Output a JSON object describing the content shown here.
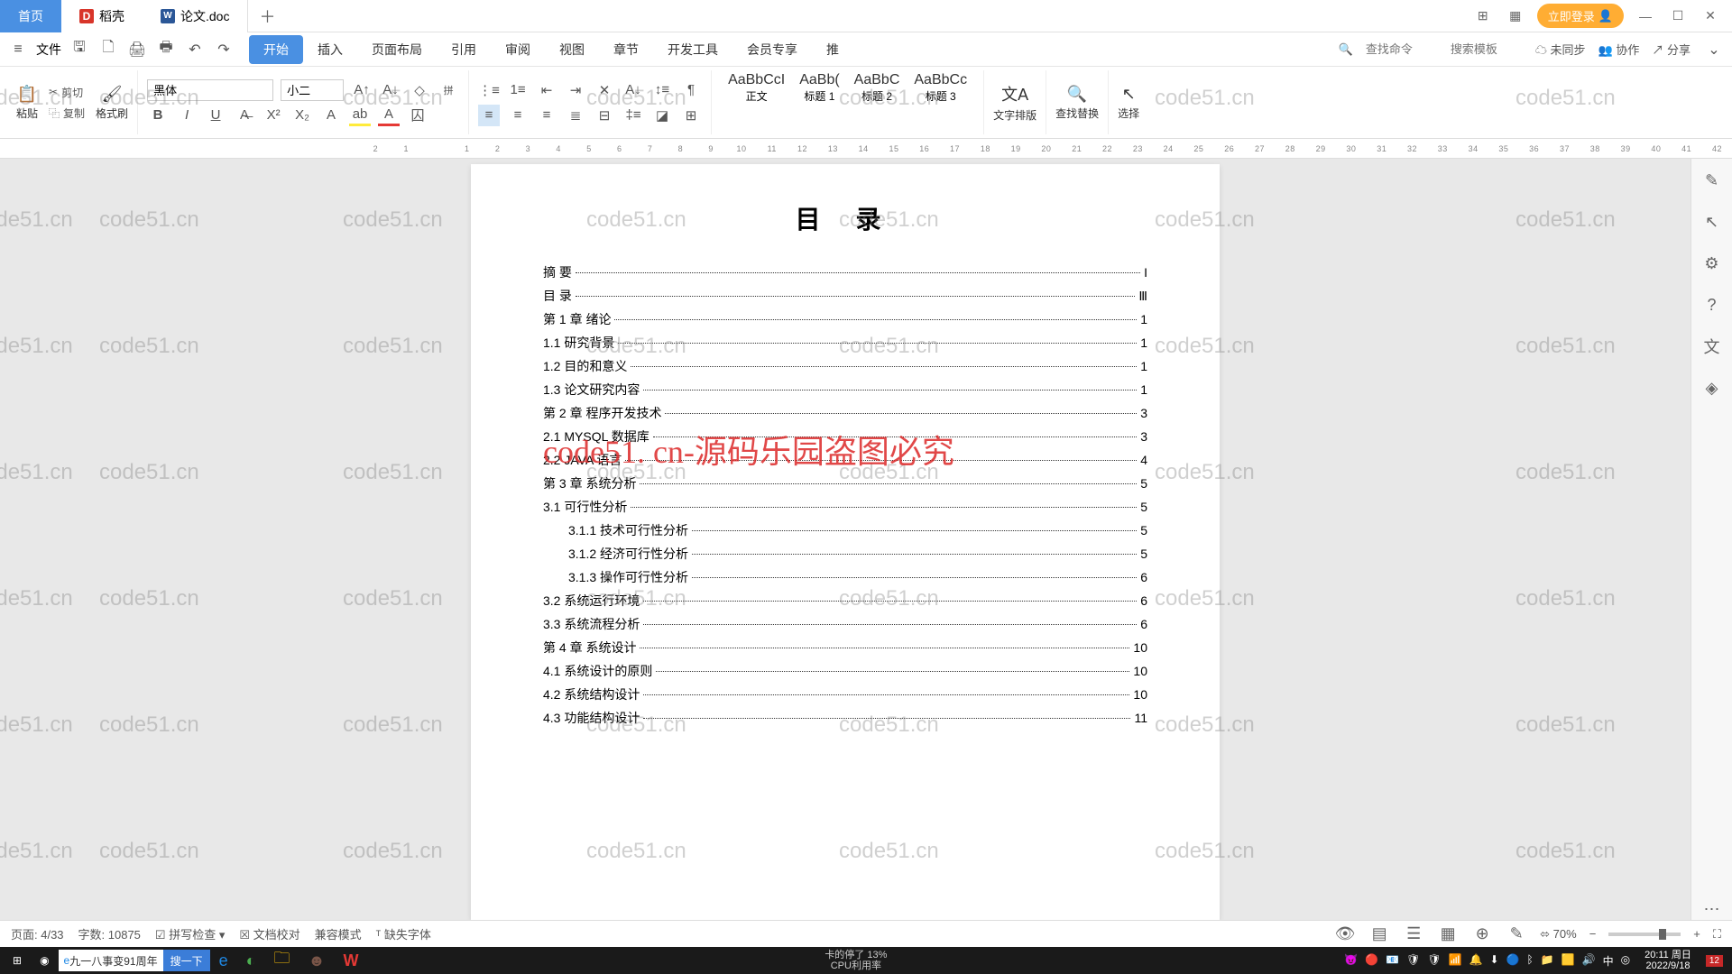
{
  "tabs": {
    "home": "首页",
    "docer": "稻壳",
    "active": "论文.doc"
  },
  "titlebar": {
    "login": "立即登录"
  },
  "menubar": {
    "file": "文件",
    "tabs": [
      "开始",
      "插入",
      "页面布局",
      "引用",
      "审阅",
      "视图",
      "章节",
      "开发工具",
      "会员专享",
      "推"
    ],
    "search_cmd": "查找命令",
    "search_tpl": "搜索模板",
    "unsync": "未同步",
    "collab": "协作",
    "share": "分享"
  },
  "ribbon": {
    "cut": "剪切",
    "copy": "复制",
    "paste": "粘贴",
    "format_painter": "格式刷",
    "font": "黑体",
    "size": "小二",
    "styles": [
      {
        "preview": "AaBbCcI",
        "name": "正文"
      },
      {
        "preview": "AaBb(",
        "name": "标题 1"
      },
      {
        "preview": "AaBbC",
        "name": "标题 2"
      },
      {
        "preview": "AaBbCc",
        "name": "标题 3"
      }
    ],
    "text_layout": "文字排版",
    "find_replace": "查找替换",
    "select": "选择"
  },
  "ruler": [
    "2",
    "1",
    "",
    "1",
    "2",
    "3",
    "4",
    "5",
    "6",
    "7",
    "8",
    "9",
    "10",
    "11",
    "12",
    "13",
    "14",
    "15",
    "16",
    "17",
    "18",
    "19",
    "20",
    "21",
    "22",
    "23",
    "24",
    "25",
    "26",
    "27",
    "28",
    "29",
    "30",
    "31",
    "32",
    "33",
    "34",
    "35",
    "36",
    "37",
    "38",
    "39",
    "40",
    "41",
    "42"
  ],
  "doc": {
    "title": "目 录",
    "toc": [
      {
        "label": "摘   要",
        "page": "I",
        "indent": 0
      },
      {
        "label": "目   录",
        "page": "Ⅲ",
        "indent": 0
      },
      {
        "label": "第 1 章  绪论",
        "page": "1",
        "indent": 0
      },
      {
        "label": "1.1 研究背景",
        "page": "1",
        "indent": 0
      },
      {
        "label": "1.2 目的和意义",
        "page": "1",
        "indent": 0
      },
      {
        "label": "1.3 论文研究内容",
        "page": "1",
        "indent": 0
      },
      {
        "label": "第 2 章  程序开发技术",
        "page": "3",
        "indent": 0
      },
      {
        "label": "2.1 MYSQL 数据库",
        "page": "3",
        "indent": 0
      },
      {
        "label": "2.2 JAVA 语言",
        "page": "4",
        "indent": 0
      },
      {
        "label": "第 3 章  系统分析",
        "page": "5",
        "indent": 0
      },
      {
        "label": "3.1 可行性分析",
        "page": "5",
        "indent": 0
      },
      {
        "label": "3.1.1 技术可行性分析",
        "page": "5",
        "indent": 1
      },
      {
        "label": "3.1.2 经济可行性分析",
        "page": "5",
        "indent": 1
      },
      {
        "label": "3.1.3 操作可行性分析",
        "page": "6",
        "indent": 1
      },
      {
        "label": "3.2 系统运行环境",
        "page": "6",
        "indent": 0
      },
      {
        "label": "3.3 系统流程分析",
        "page": "6",
        "indent": 0
      },
      {
        "label": "第 4 章  系统设计",
        "page": "10",
        "indent": 0
      },
      {
        "label": "4.1 系统设计的原则",
        "page": "10",
        "indent": 0
      },
      {
        "label": "4.2 系统结构设计",
        "page": "10",
        "indent": 0
      },
      {
        "label": "4.3 功能结构设计",
        "page": "11",
        "indent": 0
      }
    ],
    "overlay": "code51. cn-源码乐园盗图必究"
  },
  "watermark_text": "code51.cn",
  "status": {
    "page": "页面: 4/33",
    "words": "字数: 10875",
    "spell": "拼写检查",
    "proof": "文档校对",
    "compat": "兼容模式",
    "missing_font": "缺失字体",
    "zoom": "70%"
  },
  "taskbar": {
    "search_text": "九一八事变91周年",
    "search_btn": "搜一下",
    "cpu_label": "CPU利用率",
    "cpu_msg": "卡的停了",
    "cpu_val": "13%",
    "ime": "中",
    "time": "20:11 周日",
    "date": "2022/9/18",
    "notif": "12"
  }
}
